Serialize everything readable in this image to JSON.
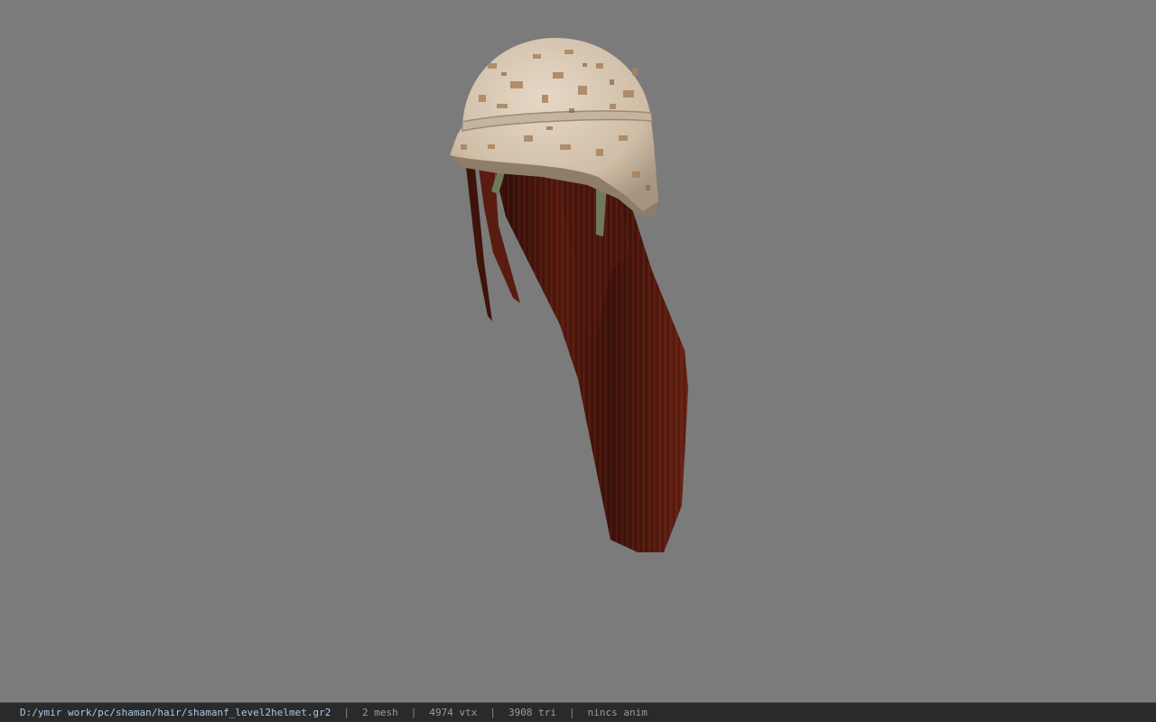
{
  "viewer": {
    "background_color": "#7b7b7b",
    "model_icon": "helmet-hair-model"
  },
  "statusbar": {
    "file_path": "D:/ymir work/pc/shaman/hair/shamanf_level2helmet.gr2",
    "separator": "|",
    "mesh_count": "2 mesh",
    "vertex_count": "4974 vtx",
    "triangle_count": "3908 tri",
    "anim_status": "nincs anim",
    "path_color": "#a8c8e8",
    "text_color": "#9a9a9a"
  }
}
